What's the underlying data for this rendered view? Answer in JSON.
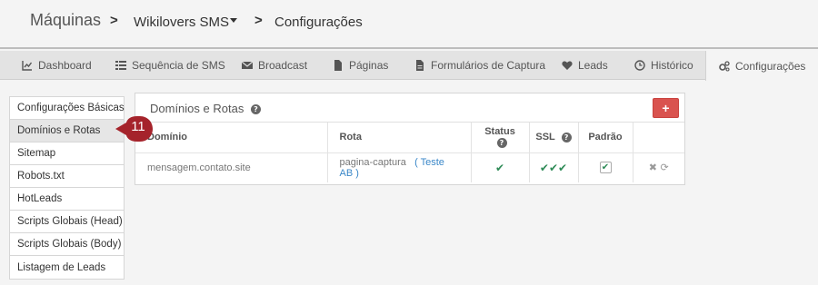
{
  "breadcrumb": {
    "root": "Máquinas",
    "machine": "Wikilovers SMS",
    "current": "Configurações"
  },
  "tabs": [
    {
      "label": "Dashboard",
      "icon": "line-chart-icon"
    },
    {
      "label": "Sequência de SMS",
      "icon": "list-icon"
    },
    {
      "label": "Broadcast",
      "icon": "envelope-icon"
    },
    {
      "label": "Páginas",
      "icon": "file-icon"
    },
    {
      "label": "Formulários de Captura",
      "icon": "file-text-icon"
    },
    {
      "label": "Leads",
      "icon": "heart-icon"
    },
    {
      "label": "Histórico",
      "icon": "clock-icon"
    },
    {
      "label": "Configurações",
      "icon": "gears-icon"
    }
  ],
  "sidemenu": [
    "Configurações Básicas",
    "Domínios e Rotas",
    "Sitemap",
    "Robots.txt",
    "HotLeads",
    "Scripts Globais (Head)",
    "Scripts Globais (Body)",
    "Listagem de Leads"
  ],
  "badge": "11",
  "panel": {
    "title": "Domínios e Rotas",
    "add_label": "+",
    "columns": {
      "domain": "Domínio",
      "route": "Rota",
      "status": "Status",
      "ssl": "SSL",
      "default": "Padrão"
    },
    "rows": [
      {
        "domain": "mensagem.contato.site",
        "route": "pagina-captura",
        "ab_open": "(",
        "ab_label": "Teste AB",
        "ab_close": ")",
        "status": "✔",
        "ssl": "✔✔✔",
        "default": "✔",
        "actions": "✖ ⟳"
      }
    ]
  },
  "colors": {
    "accent": "#d9534f",
    "badge": "#a5232b",
    "check": "#2e8b57",
    "link": "#3a87c8"
  }
}
